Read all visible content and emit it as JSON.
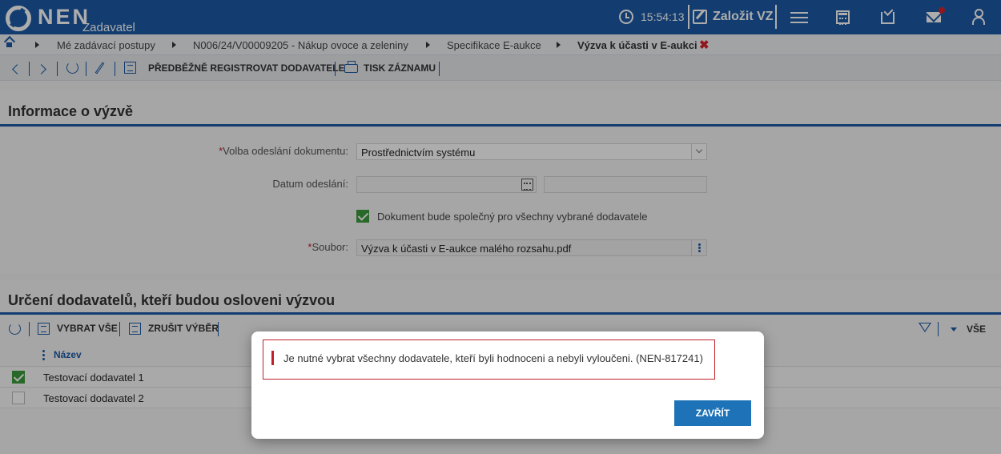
{
  "app": {
    "logo_text": "NEN",
    "logo_sub": "Zadavatel",
    "time": "15:54:13",
    "create_label": "Založit VZ"
  },
  "breadcrumb": {
    "items": [
      "Mé zadávací postupy",
      "N006/24/V00009205 - Nákup ovoce a zeleniny",
      "Specifikace E-aukce",
      "Výzva k účasti v E-aukci"
    ],
    "close_symbol": "✖"
  },
  "toolbar": {
    "preregister_label": "PŘEDBĚŽNĚ REGISTROVAT DODAVATELE",
    "print_label": "TISK ZÁZNAMU"
  },
  "info_section": {
    "title": "Informace o výzvě",
    "send_method_label": "Volba odeslání dokumentu:",
    "send_method_value": "Prostřednictvím systému",
    "send_date_label": "Datum odeslání:",
    "send_date_value": "",
    "common_doc_label": "Dokument bude společný pro všechny vybrané dodavatele",
    "common_doc_checked": true,
    "file_label": "Soubor:",
    "file_value": "Výzva k účasti v E-aukce malého rozsahu.pdf",
    "required_mark": "*"
  },
  "suppliers_section": {
    "title": "Určení dodavatelů, kteří budou osloveni výzvou",
    "select_all_label": "VYBRAT VŠE",
    "clear_selection_label": "ZRUŠIT VÝBĚR",
    "view_filter_label": "VŠE",
    "column_name": "Název",
    "rows": [
      {
        "name": "Testovací dodavatel 1",
        "checked": true
      },
      {
        "name": "Testovací dodavatel 2",
        "checked": false
      }
    ]
  },
  "modal": {
    "message": "Je nutné vybrat všechny dodavatele, kteří byli hodnoceni a nebyli vyloučeni. (NEN-817241)",
    "close_label": "ZAVŘÍT"
  },
  "colors": {
    "brand_blue": "#1d5aa6",
    "error_red": "#c0202a",
    "check_green": "#3c9a3c",
    "button_blue": "#1d72b8"
  }
}
